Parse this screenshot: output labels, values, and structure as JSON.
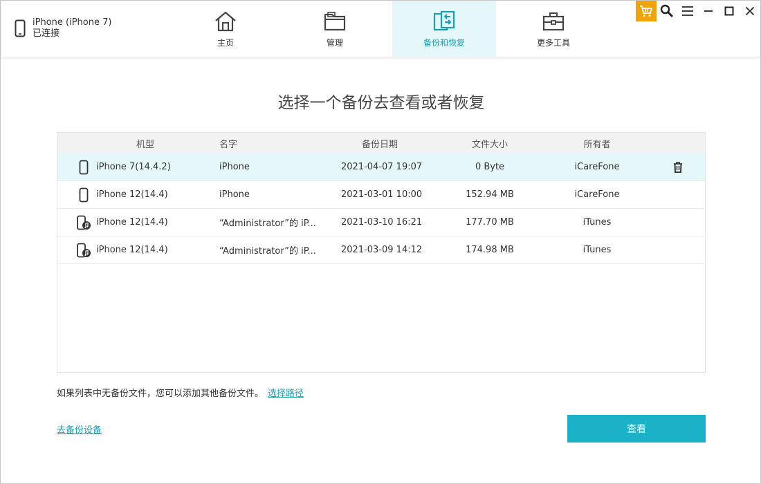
{
  "device": {
    "name": "iPhone (iPhone 7)",
    "status": "已连接"
  },
  "nav": {
    "tabs": [
      {
        "label": "主页",
        "icon": "home-icon"
      },
      {
        "label": "管理",
        "icon": "folder-icon"
      },
      {
        "label": "备份和恢复",
        "icon": "backup-restore-icon",
        "active": true
      },
      {
        "label": "更多工具",
        "icon": "toolbox-icon"
      }
    ]
  },
  "window_controls": [
    "cart-icon",
    "search-icon",
    "menu-icon",
    "minimize-icon",
    "maximize-icon",
    "close-icon"
  ],
  "page_title": "选择一个备份去查看或者恢复",
  "table": {
    "headers": {
      "model": "机型",
      "name": "名字",
      "date": "备份日期",
      "size": "文件大小",
      "owner": "所有者"
    },
    "rows": [
      {
        "icon": "phone-icon",
        "model": "iPhone 7(14.4.2)",
        "name": "iPhone",
        "date": "2021-04-07 19:07",
        "size": "0 Byte",
        "owner": "iCareFone",
        "selected": true
      },
      {
        "icon": "phone-icon",
        "model": "iPhone 12(14.4)",
        "name": "iPhone",
        "date": "2021-03-01 10:00",
        "size": "152.94 MB",
        "owner": "iCareFone"
      },
      {
        "icon": "phone-itunes-icon",
        "model": "iPhone 12(14.4)",
        "name": "“Administrator”的 iP...",
        "date": "2021-03-10 16:21",
        "size": "177.70 MB",
        "owner": "iTunes"
      },
      {
        "icon": "phone-itunes-icon",
        "model": "iPhone 12(14.4)",
        "name": "“Administrator”的 iP...",
        "date": "2021-03-09 14:12",
        "size": "174.98 MB",
        "owner": "iTunes"
      }
    ]
  },
  "hint": {
    "text": "如果列表中无备份文件，您可以添加其他备份文件。",
    "link": "选择路径"
  },
  "go_backup_link": "去备份设备",
  "view_button": "查看",
  "colors": {
    "accent": "#1bb1c6",
    "selected_bg": "#e6f7f9",
    "cart": "#f0a30a"
  }
}
